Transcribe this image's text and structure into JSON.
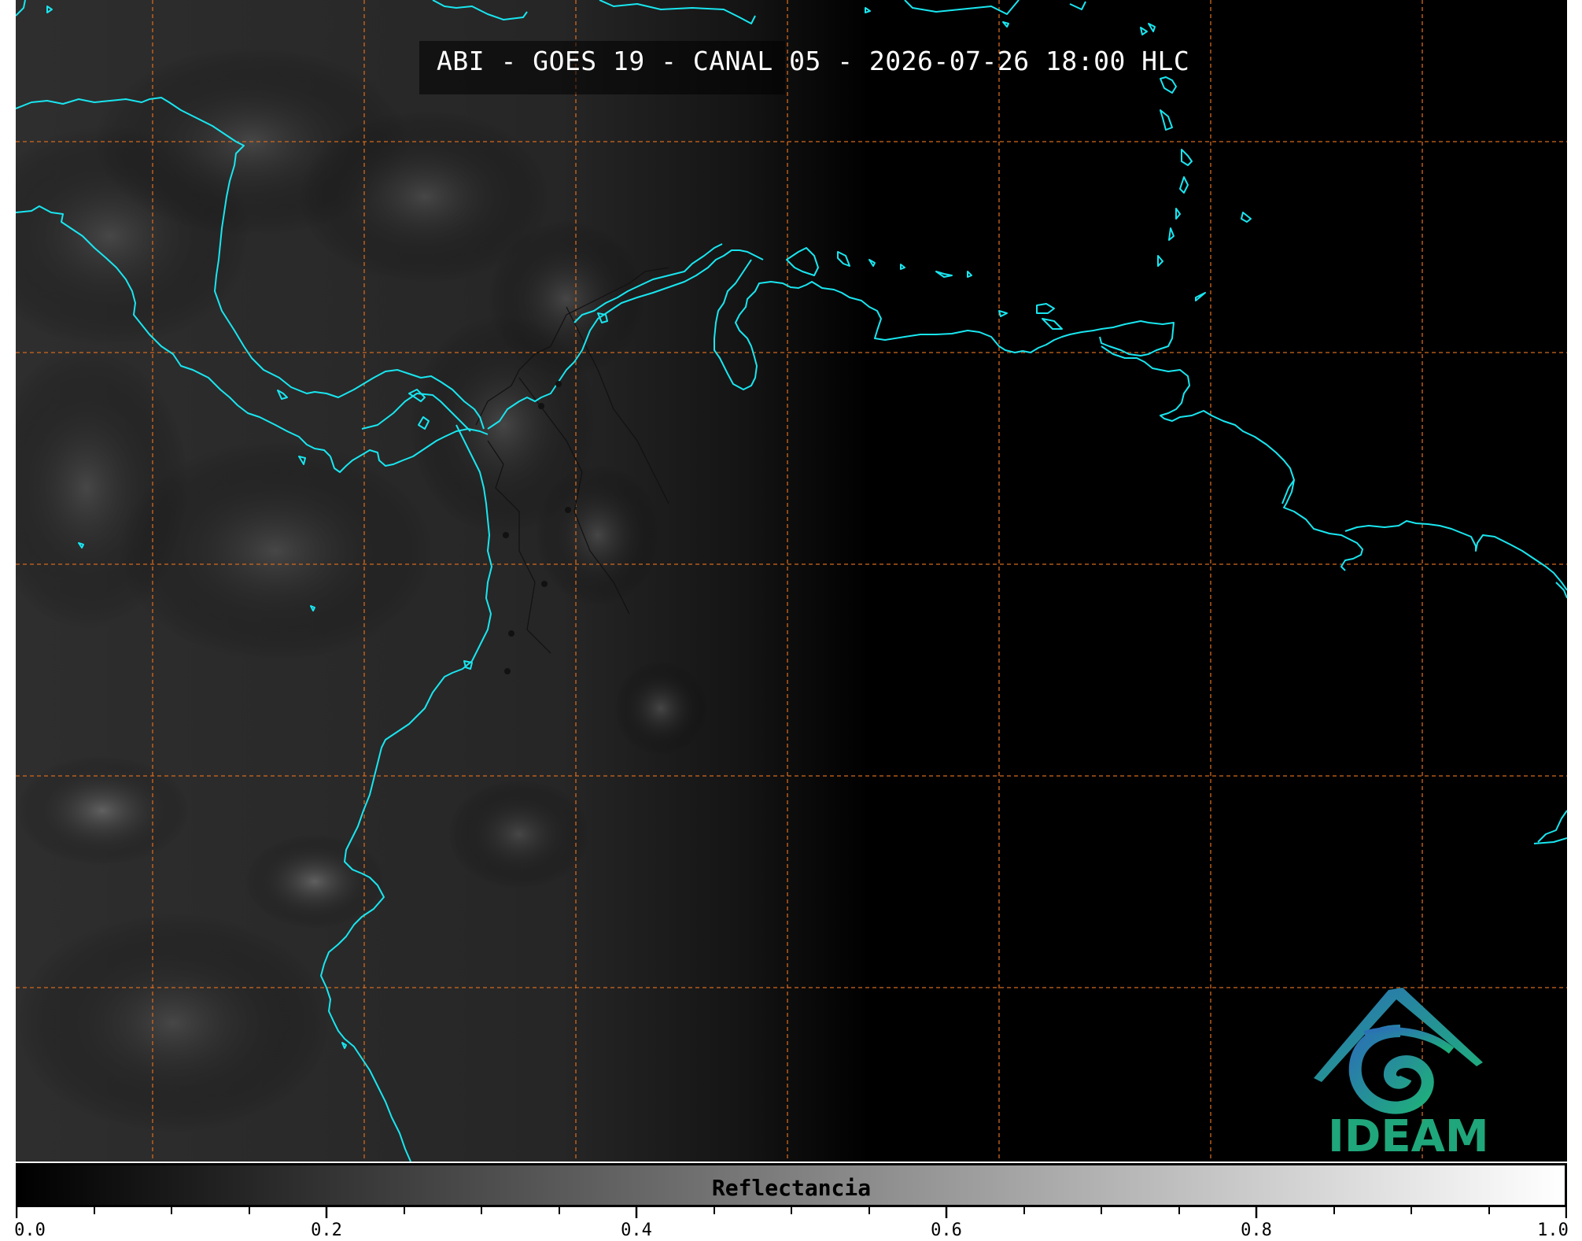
{
  "title": "ABI - GOES 19 - CANAL 05 - 2026-07-26 18:00 HLC",
  "logo": {
    "text": "IDEAM",
    "icon": "ideam-logo-icon"
  },
  "colorbar": {
    "label": "Reflectancia",
    "range": [
      0.0,
      1.0
    ],
    "major_ticks": [
      "0.0",
      "0.2",
      "0.4",
      "0.6",
      "0.8",
      "1.0"
    ],
    "colormap": "grayscale black-to-white"
  },
  "map": {
    "graticule": "dashed orange grid",
    "coastline_color": "#19e6f0",
    "grid_color": "#d2691e"
  }
}
